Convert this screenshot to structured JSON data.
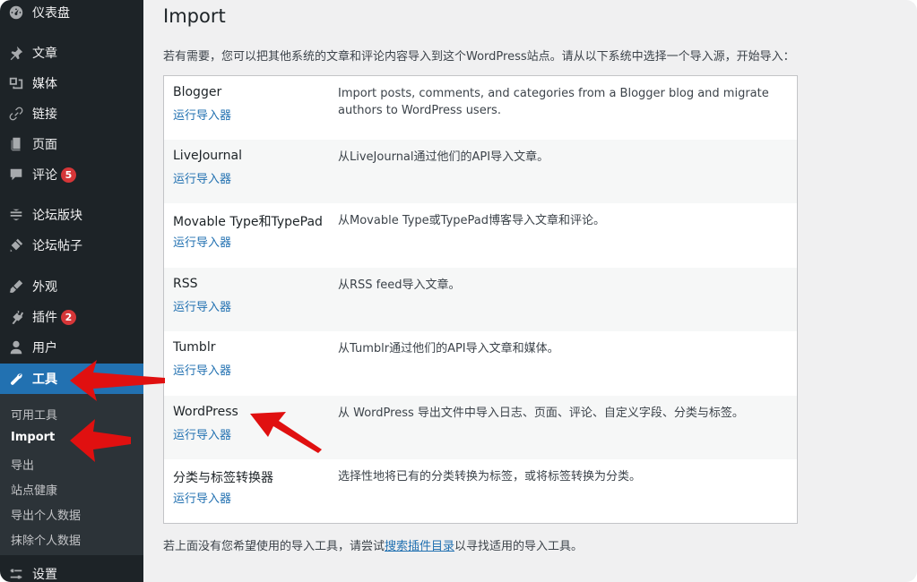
{
  "sidebar": {
    "items": [
      {
        "icon": "dashboard-icon",
        "label": "仪表盘"
      },
      {
        "icon": "pin-icon",
        "label": "文章"
      },
      {
        "icon": "media-icon",
        "label": "媒体"
      },
      {
        "icon": "link-icon",
        "label": "链接"
      },
      {
        "icon": "page-icon",
        "label": "页面"
      },
      {
        "icon": "comment-icon",
        "label": "评论",
        "badge": "5"
      },
      {
        "icon": "forum-icon",
        "label": "论坛版块"
      },
      {
        "icon": "topic-icon",
        "label": "论坛帖子"
      },
      {
        "icon": "appearance-icon",
        "label": "外观"
      },
      {
        "icon": "plugin-icon",
        "label": "插件",
        "badge": "2"
      },
      {
        "icon": "user-icon",
        "label": "用户"
      },
      {
        "icon": "wrench-icon",
        "label": "工具",
        "current": true
      },
      {
        "icon": "settings-icon",
        "label": "设置"
      }
    ],
    "submenu": [
      "可用工具",
      "Import",
      "导出",
      "站点健康",
      "导出个人数据",
      "抹除个人数据"
    ],
    "submenu_current": "Import"
  },
  "main": {
    "title": "Import",
    "intro": "若有需要，您可以把其他系统的文章和评论内容导入到这个WordPress站点。请从以下系统中选择一个导入源，开始导入：",
    "run_label": "运行导入器",
    "importers": [
      {
        "name": "Blogger",
        "desc": "Import posts, comments, and categories from a Blogger blog and migrate authors to WordPress users."
      },
      {
        "name": "LiveJournal",
        "desc": "从LiveJournal通过他们的API导入文章。"
      },
      {
        "name": "Movable Type和TypePad",
        "desc": "从Movable Type或TypePad博客导入文章和评论。"
      },
      {
        "name": "RSS",
        "desc": "从RSS feed导入文章。"
      },
      {
        "name": "Tumblr",
        "desc": "从Tumblr通过他们的API导入文章和媒体。"
      },
      {
        "name": "WordPress",
        "desc": "从 WordPress 导出文件中导入日志、页面、评论、自定义字段、分类与标签。"
      },
      {
        "name": "分类与标签转换器",
        "desc": "选择性地将已有的分类转换为标签，或将标签转换为分类。"
      }
    ],
    "footer_before": "若上面没有您希望使用的导入工具，请尝试",
    "footer_link": "搜索插件目录",
    "footer_after": "以寻找适用的导入工具。"
  },
  "colors": {
    "sidebar_bg": "#1d2327",
    "accent": "#2271b1",
    "annotation_arrow": "#e01010"
  }
}
